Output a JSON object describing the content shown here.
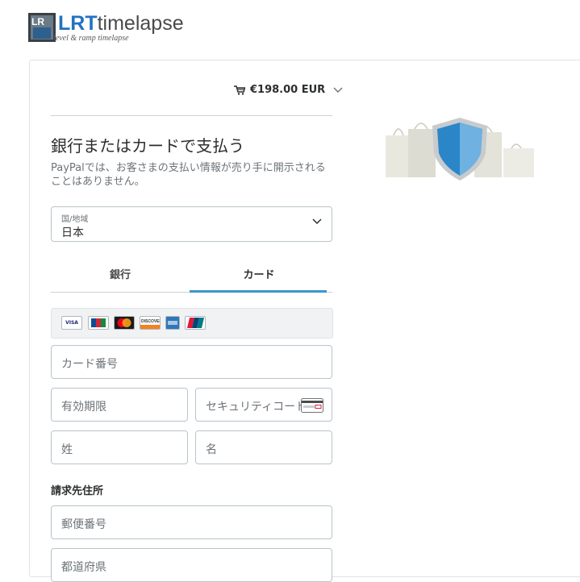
{
  "logo": {
    "brand_bold": "LRT",
    "brand_rest": "timelapse",
    "tagline": "level & ramp timelapse"
  },
  "cart": {
    "amount": "€198.00 EUR"
  },
  "form": {
    "title": "銀行またはカードで支払う",
    "subtitle": "PayPalでは、お客さまの支払い情報が売り手に開示されることはありません。",
    "country_label": "国/地域",
    "country_value": "日本",
    "tabs": [
      {
        "label": "銀行"
      },
      {
        "label": "カード"
      }
    ],
    "card_brands": [
      "VISA",
      "JCB",
      "MasterCard",
      "DISCOVER",
      "AMEX",
      "UnionPay"
    ],
    "card_number_placeholder": "カード番号",
    "expiry_placeholder": "有効期限",
    "security_code_placeholder": "セキュリティコード",
    "last_name_placeholder": "姓",
    "first_name_placeholder": "名",
    "billing_title": "請求先住所",
    "postal_code_placeholder": "郵便番号",
    "prefecture_placeholder": "都道府県"
  },
  "colors": {
    "accent": "#3d95ce",
    "brand_blue": "#2272c3",
    "shield": "#2b86c8"
  }
}
